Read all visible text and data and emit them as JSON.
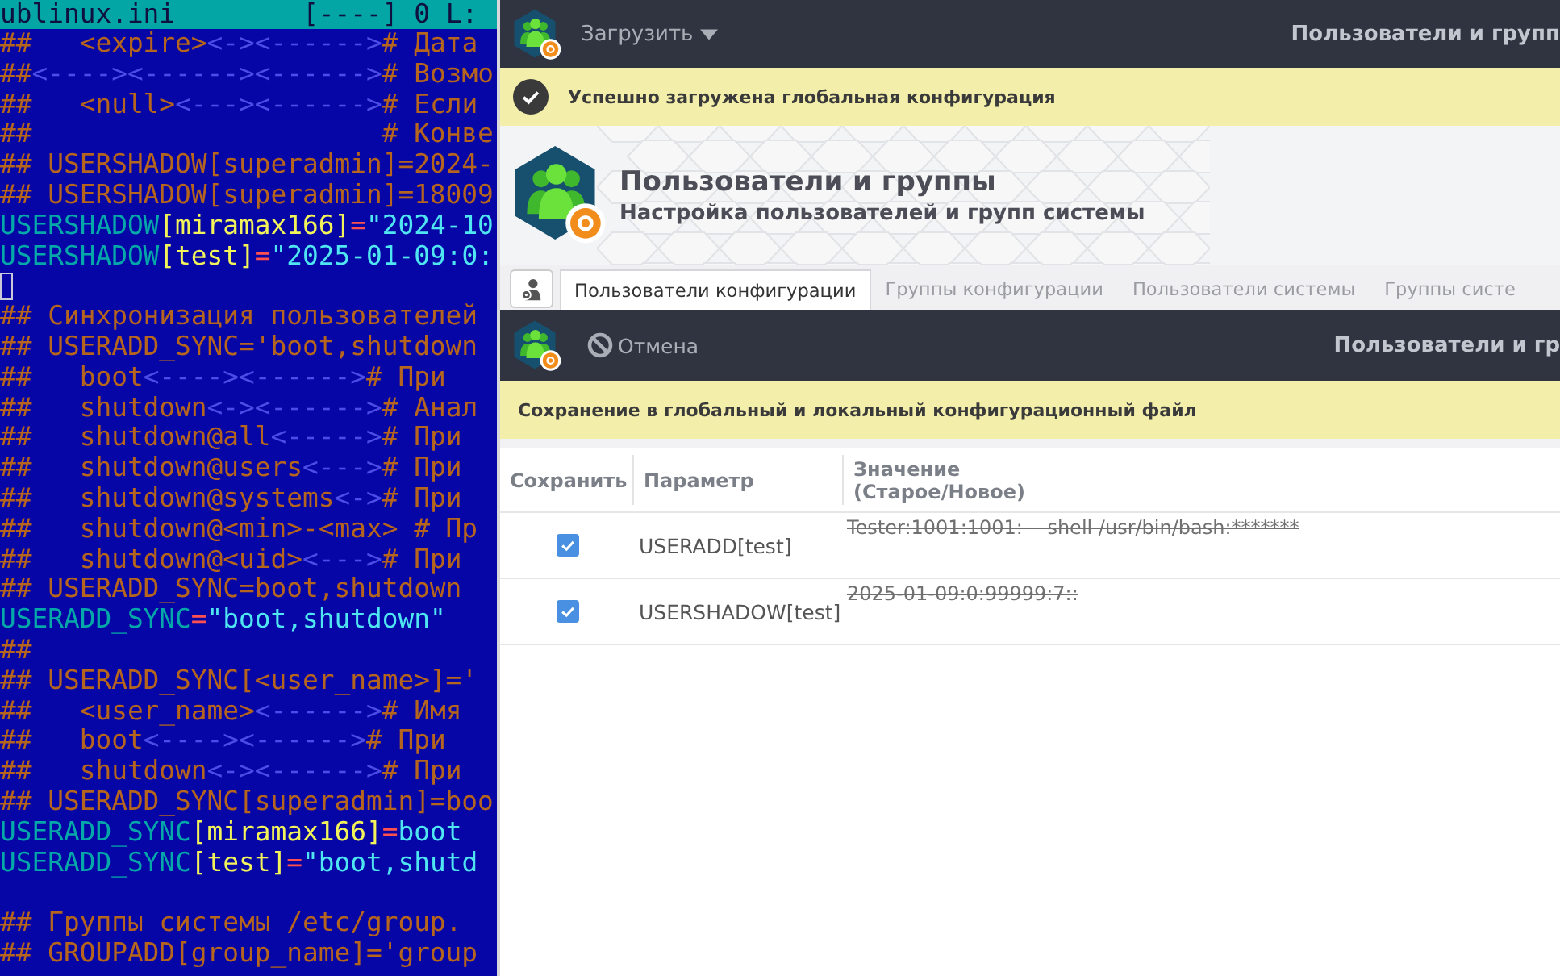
{
  "editor": {
    "file_name": "ublinux.ini",
    "status": "[----]  0 L:",
    "lines": [
      {
        "kind": "code",
        "segments": [
          {
            "kind": "comment",
            "text": "##   <expire>"
          },
          {
            "kind": "tab",
            "text": "<-><------>"
          },
          {
            "kind": "comment",
            "text": "# Дата"
          }
        ]
      },
      {
        "kind": "code",
        "segments": [
          {
            "kind": "comment",
            "text": "##"
          },
          {
            "kind": "tab",
            "text": "<----><------><------>"
          },
          {
            "kind": "comment",
            "text": "# Возмо"
          }
        ]
      },
      {
        "kind": "code",
        "segments": [
          {
            "kind": "comment",
            "text": "##   <null>"
          },
          {
            "kind": "tab",
            "text": "<---><------>"
          },
          {
            "kind": "comment",
            "text": "# Если"
          }
        ]
      },
      {
        "kind": "code",
        "segments": [
          {
            "kind": "comment",
            "text": "##                      # Конве"
          }
        ]
      },
      {
        "kind": "code",
        "segments": [
          {
            "kind": "comment",
            "text": "## USERSHADOW[superadmin]=2024-"
          }
        ]
      },
      {
        "kind": "code",
        "segments": [
          {
            "kind": "comment",
            "text": "## USERSHADOW[superadmin]=18009"
          }
        ]
      },
      {
        "kind": "code",
        "segments": [
          {
            "kind": "variable",
            "text": "USERSHADOW"
          },
          {
            "kind": "bracket",
            "text": "[miramax166]"
          },
          {
            "kind": "equals",
            "text": "="
          },
          {
            "kind": "value",
            "text": "\"2024-10"
          }
        ]
      },
      {
        "kind": "code",
        "segments": [
          {
            "kind": "variable",
            "text": "USERSHADOW"
          },
          {
            "kind": "bracket",
            "text": "[test]"
          },
          {
            "kind": "equals",
            "text": "="
          },
          {
            "kind": "value",
            "text": "\"2025-01-09:0:"
          }
        ]
      },
      {
        "kind": "cursor"
      },
      {
        "kind": "code",
        "segments": [
          {
            "kind": "comment",
            "text": "## Синхронизация пользователей"
          }
        ]
      },
      {
        "kind": "code",
        "segments": [
          {
            "kind": "comment",
            "text": "## USERADD_SYNC='boot,shutdown"
          }
        ]
      },
      {
        "kind": "code",
        "segments": [
          {
            "kind": "comment",
            "text": "##   boot"
          },
          {
            "kind": "tab",
            "text": "<----><------>"
          },
          {
            "kind": "comment",
            "text": "# При"
          }
        ]
      },
      {
        "kind": "code",
        "segments": [
          {
            "kind": "comment",
            "text": "##   shutdown"
          },
          {
            "kind": "tab",
            "text": "<-><------>"
          },
          {
            "kind": "comment",
            "text": "# Анал"
          }
        ]
      },
      {
        "kind": "code",
        "segments": [
          {
            "kind": "comment",
            "text": "##   shutdown@all"
          },
          {
            "kind": "tab",
            "text": "<----->"
          },
          {
            "kind": "comment",
            "text": "# При"
          }
        ]
      },
      {
        "kind": "code",
        "segments": [
          {
            "kind": "comment",
            "text": "##   shutdown@users"
          },
          {
            "kind": "tab",
            "text": "<--->"
          },
          {
            "kind": "comment",
            "text": "# При"
          }
        ]
      },
      {
        "kind": "code",
        "segments": [
          {
            "kind": "comment",
            "text": "##   shutdown@systems"
          },
          {
            "kind": "tab",
            "text": "<->"
          },
          {
            "kind": "comment",
            "text": "# При"
          }
        ]
      },
      {
        "kind": "code",
        "segments": [
          {
            "kind": "comment",
            "text": "##   shutdown@<min>-<max> # Пр"
          }
        ]
      },
      {
        "kind": "code",
        "segments": [
          {
            "kind": "comment",
            "text": "##   shutdown@<uid>"
          },
          {
            "kind": "tab",
            "text": "<--->"
          },
          {
            "kind": "comment",
            "text": "# При"
          }
        ]
      },
      {
        "kind": "code",
        "segments": [
          {
            "kind": "comment",
            "text": "## USERADD_SYNC=boot,shutdown"
          }
        ]
      },
      {
        "kind": "code",
        "segments": [
          {
            "kind": "variable",
            "text": "USERADD_SYNC"
          },
          {
            "kind": "equals",
            "text": "="
          },
          {
            "kind": "value",
            "text": "\"boot,shutdown\""
          }
        ]
      },
      {
        "kind": "code",
        "segments": [
          {
            "kind": "comment",
            "text": "##"
          }
        ]
      },
      {
        "kind": "code",
        "segments": [
          {
            "kind": "comment",
            "text": "## USERADD_SYNC[<user_name>]='"
          }
        ]
      },
      {
        "kind": "code",
        "segments": [
          {
            "kind": "comment",
            "text": "##   <user_name>"
          },
          {
            "kind": "tab",
            "text": "<------>"
          },
          {
            "kind": "comment",
            "text": "# Имя"
          }
        ]
      },
      {
        "kind": "code",
        "segments": [
          {
            "kind": "comment",
            "text": "##   boot"
          },
          {
            "kind": "tab",
            "text": "<----><------>"
          },
          {
            "kind": "comment",
            "text": "# При"
          }
        ]
      },
      {
        "kind": "code",
        "segments": [
          {
            "kind": "comment",
            "text": "##   shutdown"
          },
          {
            "kind": "tab",
            "text": "<-><------>"
          },
          {
            "kind": "comment",
            "text": "# При"
          }
        ]
      },
      {
        "kind": "code",
        "segments": [
          {
            "kind": "comment",
            "text": "## USERADD_SYNC[superadmin]=boo"
          }
        ]
      },
      {
        "kind": "code",
        "segments": [
          {
            "kind": "variable",
            "text": "USERADD_SYNC"
          },
          {
            "kind": "bracket",
            "text": "[miramax166]"
          },
          {
            "kind": "equals",
            "text": "="
          },
          {
            "kind": "value",
            "text": "boot"
          }
        ]
      },
      {
        "kind": "code",
        "segments": [
          {
            "kind": "variable",
            "text": "USERADD_SYNC"
          },
          {
            "kind": "bracket",
            "text": "[test]"
          },
          {
            "kind": "equals",
            "text": "="
          },
          {
            "kind": "value",
            "text": "\"boot,shutd"
          }
        ]
      },
      {
        "kind": "blank"
      },
      {
        "kind": "code",
        "segments": [
          {
            "kind": "comment",
            "text": "## Группы системы /etc/group."
          }
        ]
      },
      {
        "kind": "code",
        "segments": [
          {
            "kind": "comment",
            "text": "## GROUPADD[group_name]='group"
          }
        ]
      }
    ]
  },
  "main_window": {
    "menu_button": "Загрузить",
    "title": "Пользователи и групп",
    "notice": "Успешно загружена глобальная конфигурация",
    "banner": {
      "title": "Пользователи и группы",
      "subtitle": "Настройка пользователей и групп системы"
    },
    "tabs": [
      {
        "label": "Пользователи конфигурации",
        "selected": true
      },
      {
        "label": "Группы конфигурации",
        "selected": false
      },
      {
        "label": "Пользователи системы",
        "selected": false
      },
      {
        "label": "Группы систе",
        "selected": false
      }
    ]
  },
  "dialog": {
    "cancel_button": "Отмена",
    "title": "Пользователи и гр",
    "notice": "Сохранение в глобальный и локальный конфигурационный файл",
    "table": {
      "columns": [
        "Сохранить",
        "Параметр",
        "Значение (Старое/Новое)"
      ],
      "rows": [
        {
          "save": true,
          "parameter": "USERADD[test]",
          "old_value": "Tester:1001:1001:    shell /usr/bin/bash:*******"
        },
        {
          "save": true,
          "parameter": "USERSHADOW[test]",
          "old_value": "2025-01-09:0:99999:7::"
        }
      ]
    }
  }
}
